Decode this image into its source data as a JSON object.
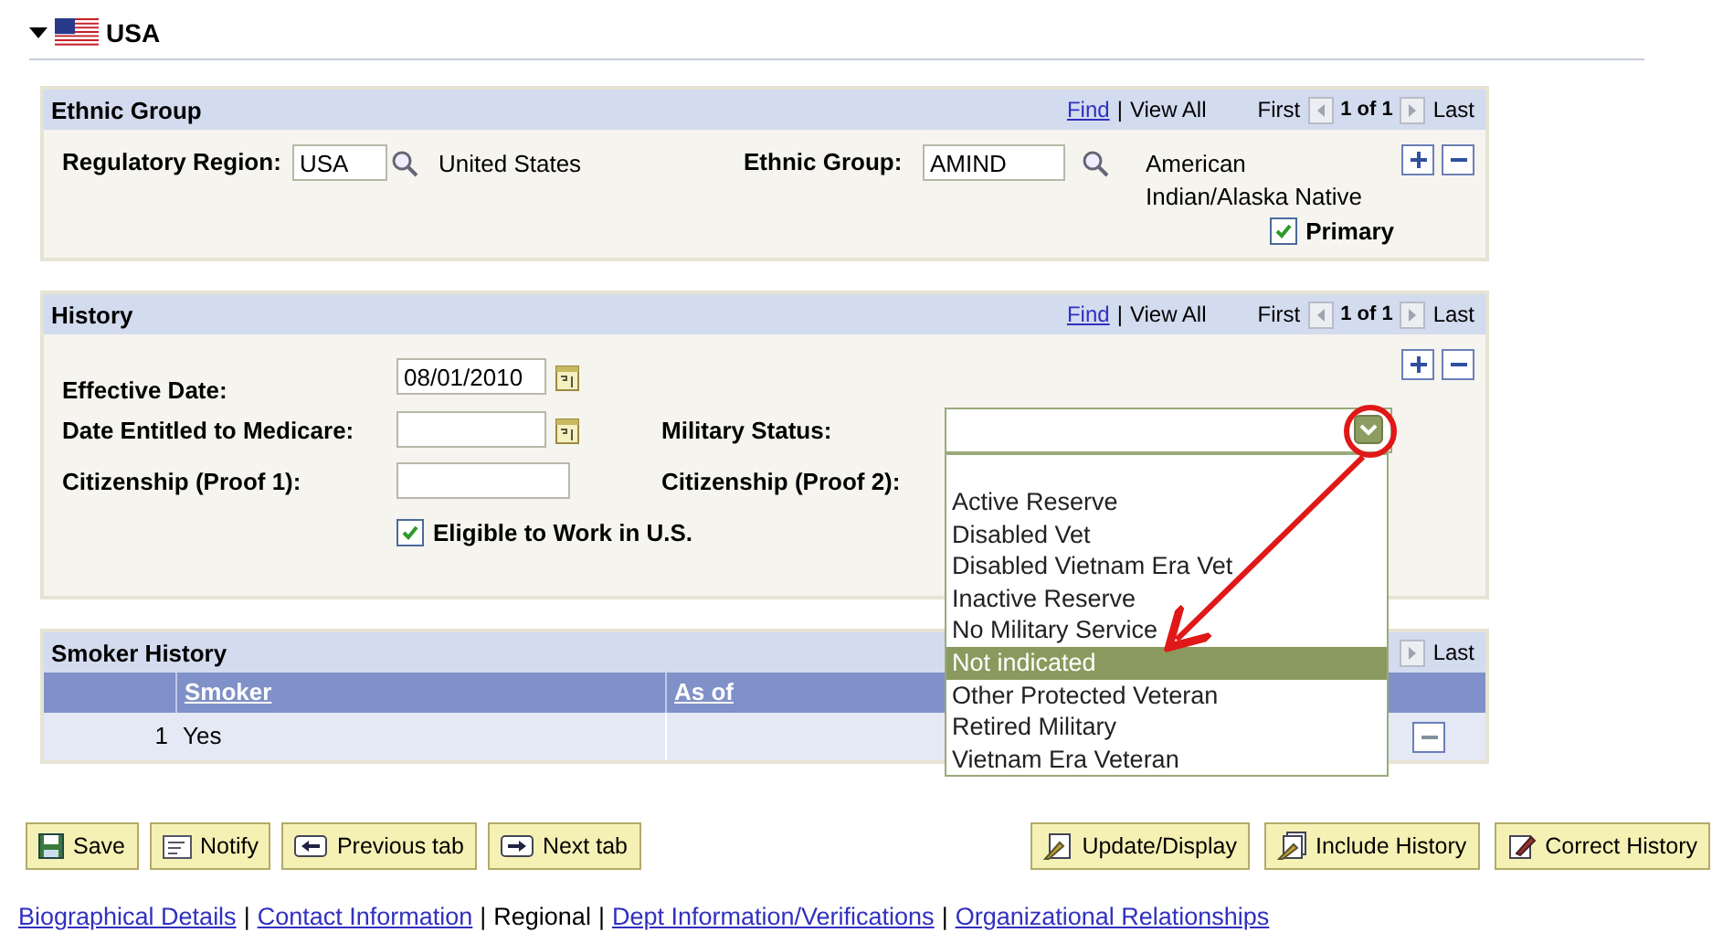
{
  "section": {
    "title": "USA",
    "expanded": true
  },
  "ethnic_group": {
    "title": "Ethnic Group",
    "nav": {
      "find": "Find",
      "separator": "|",
      "view_all": "View All",
      "first": "First",
      "count": "1 of 1",
      "last": "Last"
    },
    "regulatory_region": {
      "label": "Regulatory Region:",
      "value": "USA",
      "description": "United States"
    },
    "group": {
      "label": "Ethnic Group:",
      "value": "AMIND",
      "description": "American Indian/Alaska Native"
    },
    "primary": {
      "label": "Primary",
      "checked": true
    }
  },
  "history": {
    "title": "History",
    "nav": {
      "find": "Find",
      "separator": "|",
      "view_all": "View All",
      "first": "First",
      "count": "1 of 1",
      "last": "Last"
    },
    "effective_date": {
      "label": "Effective Date:",
      "value": "08/01/2010"
    },
    "medicare_date": {
      "label": "Date Entitled to Medicare:"
    },
    "citizenship_1": {
      "label": "Citizenship (Proof 1):"
    },
    "military_status": {
      "label": "Military Status:",
      "expanded": true,
      "options": [
        {
          "label": "Active Reserve",
          "selected": false
        },
        {
          "label": "Disabled Vet",
          "selected": false
        },
        {
          "label": "Disabled Vietnam Era Vet",
          "selected": false
        },
        {
          "label": "Inactive Reserve",
          "selected": false
        },
        {
          "label": "No Military Service",
          "selected": false
        },
        {
          "label": "Not indicated",
          "selected": true
        },
        {
          "label": "Other Protected Veteran",
          "selected": false
        },
        {
          "label": "Retired Military",
          "selected": false
        },
        {
          "label": "Vietnam Era Veteran",
          "selected": false
        }
      ]
    },
    "citizenship_2": {
      "label": "Citizenship (Proof 2):"
    },
    "eligible": {
      "label": "Eligible to Work in U.S.",
      "checked": true
    }
  },
  "smoker_history": {
    "title": "Smoker History",
    "last": "Last",
    "columns": [
      "Smoker",
      "As of"
    ],
    "rows": [
      {
        "number": "1",
        "smoker": "Yes"
      }
    ]
  },
  "buttons_left": [
    {
      "label": "Save",
      "kind": "save"
    },
    {
      "label": "Notify",
      "kind": "notify"
    },
    {
      "label": "Previous tab",
      "kind": "prev"
    },
    {
      "label": "Next tab",
      "kind": "next"
    }
  ],
  "buttons_right": [
    {
      "label": "Update/Display",
      "kind": "update"
    },
    {
      "label": "Include History",
      "kind": "include"
    },
    {
      "label": "Correct History",
      "kind": "correct"
    }
  ],
  "links": [
    {
      "label": "Biographical Details",
      "current": false
    },
    {
      "label": "Contact Information",
      "current": false
    },
    {
      "label": "Regional",
      "current": true
    },
    {
      "label": "Dept Information/Verifications",
      "current": false
    },
    {
      "label": "Organizational Relationships",
      "current": false
    }
  ],
  "link_separator": "|"
}
